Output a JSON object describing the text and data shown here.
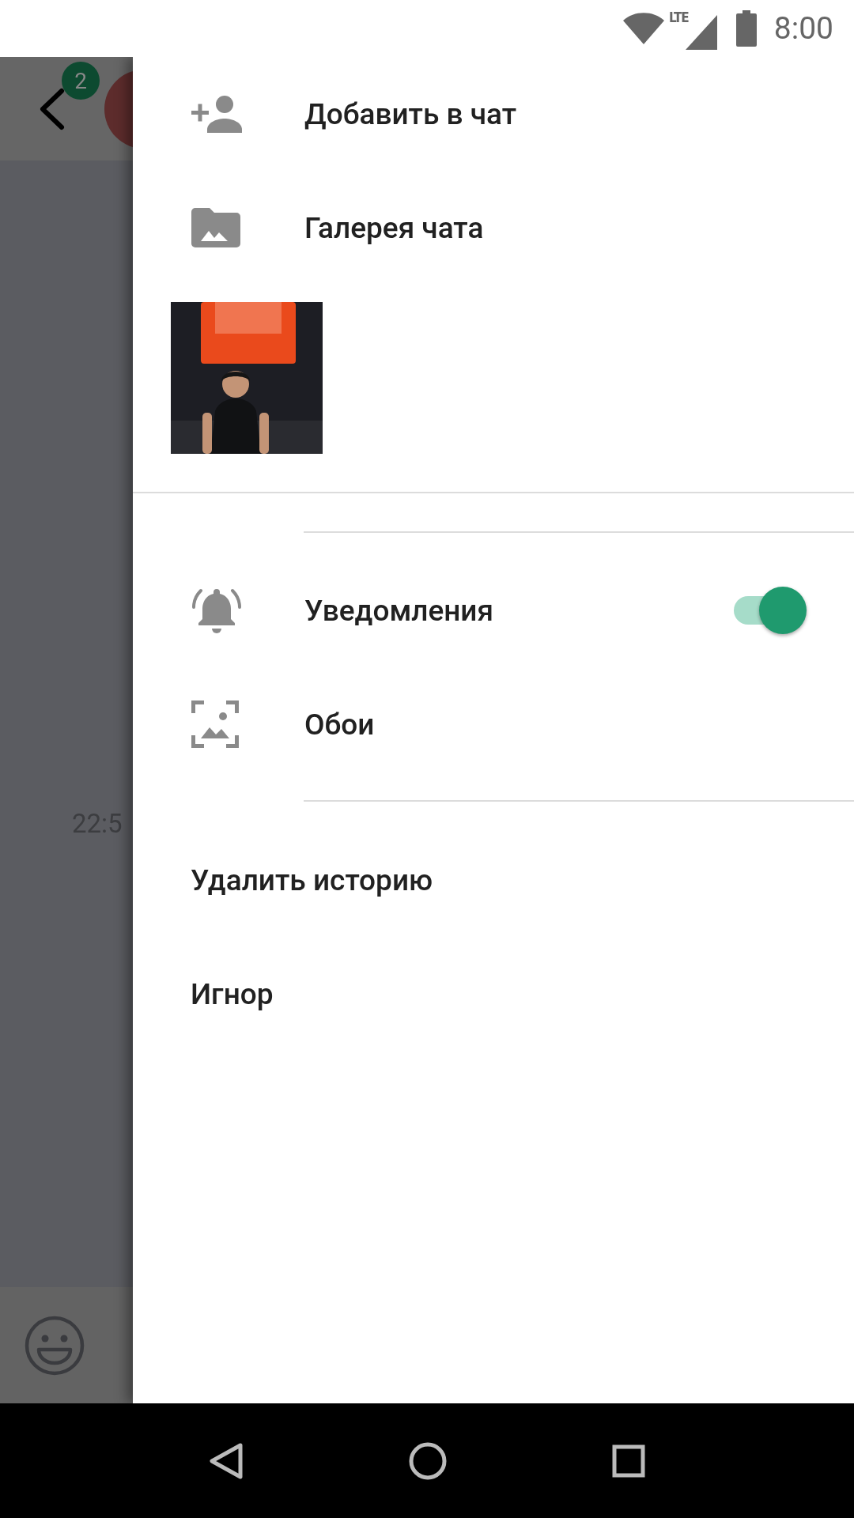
{
  "status_bar": {
    "network": "LTE",
    "time": "8:00"
  },
  "chat": {
    "unread_badge": "2",
    "message_time": "22:5"
  },
  "drawer": {
    "actions": [
      {
        "label": "Добавить в чат",
        "kind": "add-member"
      },
      {
        "label": "Галерея чата",
        "kind": "gallery"
      }
    ],
    "settings": [
      {
        "label": "Уведомления",
        "kind": "toggle",
        "on": true
      },
      {
        "label": "Обои",
        "kind": "wallpaper"
      }
    ],
    "options": [
      {
        "label": "Удалить историю"
      },
      {
        "label": "Игнор"
      }
    ]
  }
}
